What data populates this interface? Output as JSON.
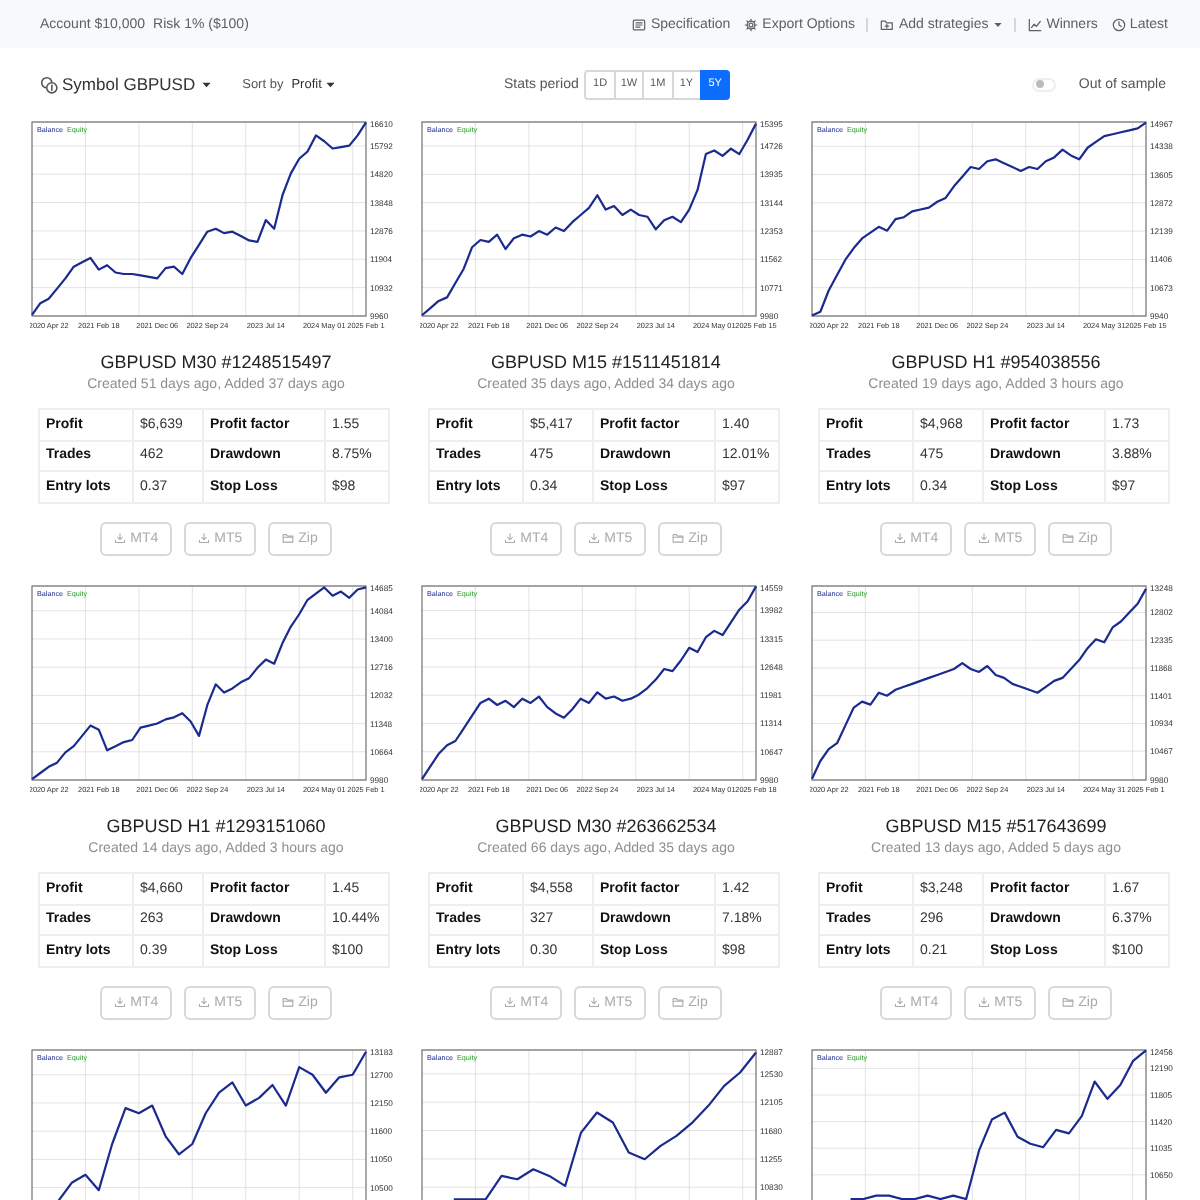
{
  "top_bar": {
    "account": "Account $10,000",
    "risk": "Risk 1% ($100)",
    "nav_groups": [
      {
        "items": [
          {
            "label": "Specification",
            "kind": "spec",
            "dropdown": false
          },
          {
            "label": "Export Options",
            "kind": "export",
            "dropdown": false
          }
        ]
      },
      {
        "items": [
          {
            "label": "Add strategies",
            "kind": "add",
            "dropdown": true
          }
        ]
      },
      {
        "items": [
          {
            "label": "Winners",
            "kind": "winners",
            "dropdown": false
          },
          {
            "label": "Latest",
            "kind": "latest",
            "dropdown": false
          }
        ]
      }
    ]
  },
  "toolbar": {
    "symbol": {
      "label": "Symbol GBPUSD"
    },
    "sort": {
      "label": "Sort by",
      "value": "Profit"
    },
    "stats_period": {
      "label": "Stats period",
      "options": [
        {
          "label": "1D",
          "selected": false
        },
        {
          "label": "1W",
          "selected": false
        },
        {
          "label": "1M",
          "selected": false
        },
        {
          "label": "1Y",
          "selected": false
        },
        {
          "label": "5Y",
          "selected": true
        }
      ]
    },
    "out_of_sample": {
      "label": "Out of sample",
      "on": false
    }
  },
  "cards": [
    {
      "chart_data": {
        "type": "line",
        "grid": true,
        "categories": [
          null,
          null,
          "2020 Apr 22",
          null,
          null,
          null,
          null,
          null,
          "2021 Feb 18",
          null,
          null,
          null,
          null,
          null,
          null,
          "2021 Dec 06",
          null,
          null,
          null,
          null,
          null,
          "2022 Sep 24",
          null,
          null,
          null,
          null,
          null,
          null,
          "2023 Jul 14",
          null,
          null,
          null,
          null,
          null,
          null,
          "2024 May 01",
          null,
          null,
          null,
          null,
          "2025 Feb 1"
        ],
        "ylim": [
          9960,
          16610
        ],
        "yticks": [
          9960,
          10932,
          11904,
          12876,
          13848,
          14820,
          15792,
          16610
        ],
        "series": [
          {
            "name": "Balance",
            "color": "#1b2a8e",
            "values": [
              10000,
              10400,
              10550,
              10900,
              11250,
              11650,
              11800,
              11950,
              11550,
              11700,
              11450,
              11400,
              11400,
              11350,
              11300,
              11250,
              11600,
              11650,
              11400,
              11950,
              12400,
              12850,
              12950,
              12800,
              12850,
              12700,
              12550,
              12500,
              13250,
              12950,
              14100,
              14850,
              15350,
              15600,
              16150,
              15950,
              15700,
              15750,
              15800,
              16150,
              16600
            ]
          },
          {
            "name": "Equity",
            "color": "#22a022",
            "values": [
              null,
              null,
              null,
              null,
              null,
              null,
              null,
              null,
              null,
              null,
              null,
              null,
              null,
              null,
              null,
              null,
              null,
              null,
              null,
              null,
              null,
              null,
              null,
              null,
              null,
              null,
              null,
              null,
              null,
              null,
              null,
              null,
              null,
              null,
              null,
              null,
              null,
              null,
              null,
              null,
              null
            ]
          }
        ]
      },
      "title": "GBPUSD M30 #1248515497",
      "subtitle": "Created 51 days ago, Added 37 days ago",
      "stats": [
        {
          "label": "Profit",
          "value": "$6,639"
        },
        {
          "label": "Profit factor",
          "value": "1.55"
        },
        {
          "label": "Trades",
          "value": "462"
        },
        {
          "label": "Drawdown",
          "value": "8.75%"
        },
        {
          "label": "Entry lots",
          "value": "0.37"
        },
        {
          "label": "Stop Loss",
          "value": "$98"
        }
      ],
      "buttons": [
        {
          "label": "MT4",
          "kind": "download",
          "disabled": true
        },
        {
          "label": "MT5",
          "kind": "download",
          "disabled": true
        },
        {
          "label": "Zip",
          "kind": "archive",
          "disabled": true
        }
      ]
    },
    {
      "chart_data": {
        "type": "line",
        "grid": true,
        "categories": [
          null,
          null,
          "2020 Apr 22",
          null,
          null,
          null,
          null,
          null,
          "2021 Feb 18",
          null,
          null,
          null,
          null,
          null,
          null,
          "2021 Dec 06",
          null,
          null,
          null,
          null,
          null,
          "2022 Sep 24",
          null,
          null,
          null,
          null,
          null,
          null,
          "2023 Jul 14",
          null,
          null,
          null,
          null,
          null,
          null,
          "2024 May 01",
          null,
          null,
          null,
          null,
          "2025 Feb 15"
        ],
        "ylim": [
          9980,
          15395
        ],
        "yticks": [
          9980,
          10771,
          11562,
          12353,
          13144,
          13935,
          14726,
          15395
        ],
        "series": [
          {
            "name": "Balance",
            "color": "#1b2a8e",
            "values": [
              10000,
              10200,
              10400,
              10500,
              10900,
              11300,
              11900,
              12100,
              12050,
              12250,
              11850,
              12150,
              12250,
              12200,
              12350,
              12250,
              12450,
              12350,
              12600,
              12800,
              13000,
              13350,
              12950,
              13050,
              12800,
              12950,
              12800,
              12750,
              12400,
              12650,
              12750,
              12600,
              12950,
              13500,
              14500,
              14600,
              14450,
              14650,
              14500,
              14900,
              15350
            ]
          },
          {
            "name": "Equity",
            "color": "#22a022",
            "values": [
              null,
              null,
              null,
              null,
              null,
              null,
              null,
              null,
              null,
              null,
              null,
              null,
              null,
              null,
              null,
              null,
              null,
              null,
              null,
              null,
              null,
              null,
              null,
              null,
              null,
              null,
              null,
              null,
              null,
              null,
              null,
              null,
              null,
              null,
              null,
              null,
              null,
              null,
              null,
              null,
              null
            ]
          }
        ]
      },
      "title": "GBPUSD M15 #1511451814",
      "subtitle": "Created 35 days ago, Added 34 days ago",
      "stats": [
        {
          "label": "Profit",
          "value": "$5,417"
        },
        {
          "label": "Profit factor",
          "value": "1.40"
        },
        {
          "label": "Trades",
          "value": "475"
        },
        {
          "label": "Drawdown",
          "value": "12.01%"
        },
        {
          "label": "Entry lots",
          "value": "0.34"
        },
        {
          "label": "Stop Loss",
          "value": "$97"
        }
      ],
      "buttons": [
        {
          "label": "MT4",
          "kind": "download",
          "disabled": true
        },
        {
          "label": "MT5",
          "kind": "download",
          "disabled": true
        },
        {
          "label": "Zip",
          "kind": "archive",
          "disabled": true
        }
      ]
    },
    {
      "chart_data": {
        "type": "line",
        "grid": true,
        "categories": [
          null,
          null,
          "2020 Apr 22",
          null,
          null,
          null,
          null,
          null,
          "2021 Feb 18",
          null,
          null,
          null,
          null,
          null,
          null,
          "2021 Dec 06",
          null,
          null,
          null,
          null,
          null,
          "2022 Sep 24",
          null,
          null,
          null,
          null,
          null,
          null,
          "2023 Jul 14",
          null,
          null,
          null,
          null,
          null,
          null,
          "2024 May 31",
          null,
          null,
          null,
          null,
          "2025 Feb 15"
        ],
        "ylim": [
          9940,
          14967
        ],
        "yticks": [
          9940,
          10673,
          11406,
          12139,
          12872,
          13605,
          14338,
          14967
        ],
        "series": [
          {
            "name": "Balance",
            "color": "#1b2a8e",
            "values": [
              9950,
              10050,
              10600,
              11000,
              11400,
              11700,
              11950,
              12100,
              12250,
              12150,
              12450,
              12500,
              12650,
              12700,
              12750,
              12900,
              13000,
              13300,
              13550,
              13800,
              13750,
              13950,
              14000,
              13900,
              13800,
              13700,
              13800,
              13750,
              13950,
              14050,
              14250,
              14100,
              14000,
              14300,
              14450,
              14600,
              14650,
              14700,
              14750,
              14800,
              14950
            ]
          },
          {
            "name": "Equity",
            "color": "#22a022",
            "values": [
              null,
              null,
              null,
              null,
              null,
              null,
              null,
              null,
              null,
              null,
              null,
              null,
              null,
              null,
              null,
              null,
              null,
              null,
              null,
              null,
              null,
              null,
              null,
              null,
              null,
              null,
              null,
              null,
              null,
              null,
              null,
              null,
              null,
              null,
              null,
              null,
              null,
              null,
              null,
              null,
              null
            ]
          }
        ]
      },
      "title": "GBPUSD H1 #954038556",
      "subtitle": "Created 19 days ago, Added 3 hours ago",
      "stats": [
        {
          "label": "Profit",
          "value": "$4,968"
        },
        {
          "label": "Profit factor",
          "value": "1.73"
        },
        {
          "label": "Trades",
          "value": "475"
        },
        {
          "label": "Drawdown",
          "value": "3.88%"
        },
        {
          "label": "Entry lots",
          "value": "0.34"
        },
        {
          "label": "Stop Loss",
          "value": "$97"
        }
      ],
      "buttons": [
        {
          "label": "MT4",
          "kind": "download",
          "disabled": true
        },
        {
          "label": "MT5",
          "kind": "download",
          "disabled": true
        },
        {
          "label": "Zip",
          "kind": "archive",
          "disabled": true
        }
      ]
    },
    {
      "chart_data": {
        "type": "line",
        "grid": true,
        "categories": [
          null,
          null,
          "2020 Apr 22",
          null,
          null,
          null,
          null,
          null,
          "2021 Feb 18",
          null,
          null,
          null,
          null,
          null,
          null,
          "2021 Dec 06",
          null,
          null,
          null,
          null,
          null,
          "2022 Sep 24",
          null,
          null,
          null,
          null,
          null,
          null,
          "2023 Jul 14",
          null,
          null,
          null,
          null,
          null,
          null,
          "2024 May 01",
          null,
          null,
          null,
          null,
          "2025 Feb 1"
        ],
        "ylim": [
          9980,
          14685
        ],
        "yticks": [
          9980,
          10664,
          11348,
          12032,
          12716,
          13400,
          14084,
          14685
        ],
        "series": [
          {
            "name": "Balance",
            "color": "#1b2a8e",
            "values": [
              10000,
              10150,
              10300,
              10400,
              10650,
              10800,
              11050,
              11300,
              11200,
              10700,
              10800,
              10900,
              10950,
              11250,
              11300,
              11350,
              11450,
              11500,
              11600,
              11400,
              11050,
              11800,
              12300,
              12100,
              12200,
              12350,
              12450,
              12700,
              12900,
              12800,
              13300,
              13700,
              14000,
              14350,
              14500,
              14650,
              14450,
              14550,
              14400,
              14600,
              14650
            ]
          },
          {
            "name": "Equity",
            "color": "#22a022",
            "values": [
              null,
              null,
              null,
              null,
              null,
              null,
              null,
              null,
              null,
              null,
              null,
              null,
              null,
              null,
              null,
              null,
              null,
              null,
              null,
              null,
              null,
              null,
              null,
              null,
              null,
              null,
              null,
              null,
              null,
              null,
              null,
              null,
              null,
              null,
              null,
              null,
              null,
              null,
              null,
              null,
              null
            ]
          }
        ]
      },
      "title": "GBPUSD H1 #1293151060",
      "subtitle": "Created 14 days ago, Added 3 hours ago",
      "stats": [
        {
          "label": "Profit",
          "value": "$4,660"
        },
        {
          "label": "Profit factor",
          "value": "1.45"
        },
        {
          "label": "Trades",
          "value": "263"
        },
        {
          "label": "Drawdown",
          "value": "10.44%"
        },
        {
          "label": "Entry lots",
          "value": "0.39"
        },
        {
          "label": "Stop Loss",
          "value": "$100"
        }
      ],
      "buttons": [
        {
          "label": "MT4",
          "kind": "download",
          "disabled": true
        },
        {
          "label": "MT5",
          "kind": "download",
          "disabled": true
        },
        {
          "label": "Zip",
          "kind": "archive",
          "disabled": true
        }
      ]
    },
    {
      "chart_data": {
        "type": "line",
        "grid": true,
        "categories": [
          null,
          null,
          "2020 Apr 22",
          null,
          null,
          null,
          null,
          null,
          "2021 Feb 18",
          null,
          null,
          null,
          null,
          null,
          null,
          "2021 Dec 06",
          null,
          null,
          null,
          null,
          null,
          "2022 Sep 24",
          null,
          null,
          null,
          null,
          null,
          null,
          "2023 Jul 14",
          null,
          null,
          null,
          null,
          null,
          null,
          "2024 May 01",
          null,
          null,
          null,
          null,
          "2025 Feb 18"
        ],
        "ylim": [
          9980,
          14559
        ],
        "yticks": [
          9980,
          10647,
          11314,
          11981,
          12648,
          13315,
          13982,
          14559
        ],
        "series": [
          {
            "name": "Balance",
            "color": "#1b2a8e",
            "values": [
              10000,
              10300,
              10600,
              10800,
              10900,
              11200,
              11500,
              11800,
              11900,
              11750,
              11850,
              11700,
              11900,
              11800,
              11950,
              11700,
              11550,
              11450,
              11650,
              11900,
              11800,
              12050,
              11900,
              11950,
              11850,
              11900,
              12000,
              12150,
              12350,
              12600,
              12550,
              12800,
              13100,
              13000,
              13350,
              13500,
              13400,
              13700,
              14000,
              14200,
              14550
            ]
          },
          {
            "name": "Equity",
            "color": "#22a022",
            "values": [
              null,
              null,
              null,
              null,
              null,
              null,
              null,
              null,
              null,
              null,
              null,
              null,
              null,
              null,
              null,
              null,
              null,
              null,
              null,
              null,
              null,
              null,
              null,
              null,
              null,
              null,
              null,
              null,
              null,
              null,
              null,
              null,
              null,
              null,
              null,
              null,
              null,
              null,
              null,
              null,
              null
            ]
          }
        ]
      },
      "title": "GBPUSD M30 #263662534",
      "subtitle": "Created 66 days ago, Added 35 days ago",
      "stats": [
        {
          "label": "Profit",
          "value": "$4,558"
        },
        {
          "label": "Profit factor",
          "value": "1.42"
        },
        {
          "label": "Trades",
          "value": "327"
        },
        {
          "label": "Drawdown",
          "value": "7.18%"
        },
        {
          "label": "Entry lots",
          "value": "0.30"
        },
        {
          "label": "Stop Loss",
          "value": "$98"
        }
      ],
      "buttons": [
        {
          "label": "MT4",
          "kind": "download",
          "disabled": true
        },
        {
          "label": "MT5",
          "kind": "download",
          "disabled": true
        },
        {
          "label": "Zip",
          "kind": "archive",
          "disabled": true
        }
      ]
    },
    {
      "chart_data": {
        "type": "line",
        "grid": true,
        "categories": [
          null,
          null,
          "2020 Apr 22",
          null,
          null,
          null,
          null,
          null,
          "2021 Feb 18",
          null,
          null,
          null,
          null,
          null,
          null,
          "2021 Dec 06",
          null,
          null,
          null,
          null,
          null,
          "2022 Sep 24",
          null,
          null,
          null,
          null,
          null,
          null,
          "2023 Jul 14",
          null,
          null,
          null,
          null,
          null,
          null,
          "2024 May 31",
          null,
          null,
          null,
          null,
          "2025 Feb 1"
        ],
        "ylim": [
          9980,
          13248
        ],
        "yticks": [
          9980,
          10467,
          10934,
          11401,
          11868,
          12335,
          12802,
          13248
        ],
        "series": [
          {
            "name": "Balance",
            "color": "#1b2a8e",
            "values": [
              10000,
              10300,
              10500,
              10600,
              10900,
              11200,
              11300,
              11250,
              11450,
              11400,
              11500,
              11550,
              11600,
              11650,
              11700,
              11750,
              11800,
              11850,
              11950,
              11850,
              11800,
              11900,
              11750,
              11700,
              11600,
              11550,
              11500,
              11450,
              11550,
              11650,
              11700,
              11850,
              12000,
              12200,
              12350,
              12300,
              12550,
              12650,
              12800,
              12950,
              13200
            ]
          },
          {
            "name": "Equity",
            "color": "#22a022",
            "values": [
              null,
              null,
              null,
              null,
              null,
              null,
              null,
              null,
              null,
              null,
              null,
              null,
              null,
              null,
              null,
              null,
              null,
              null,
              null,
              null,
              null,
              null,
              null,
              null,
              null,
              null,
              null,
              null,
              null,
              null,
              null,
              null,
              null,
              null,
              null,
              null,
              null,
              null,
              null,
              null,
              null
            ]
          }
        ]
      },
      "title": "GBPUSD M15 #517643699",
      "subtitle": "Created 13 days ago, Added 5 days ago",
      "stats": [
        {
          "label": "Profit",
          "value": "$3,248"
        },
        {
          "label": "Profit factor",
          "value": "1.67"
        },
        {
          "label": "Trades",
          "value": "296"
        },
        {
          "label": "Drawdown",
          "value": "6.37%"
        },
        {
          "label": "Entry lots",
          "value": "0.21"
        },
        {
          "label": "Stop Loss",
          "value": "$100"
        }
      ],
      "buttons": [
        {
          "label": "MT4",
          "kind": "download",
          "disabled": true
        },
        {
          "label": "MT5",
          "kind": "download",
          "disabled": true
        },
        {
          "label": "Zip",
          "kind": "archive",
          "disabled": true
        }
      ]
    },
    {
      "chart_data": {
        "type": "line",
        "grid": true,
        "ylim": [
          9400,
          13183
        ],
        "yticks": [
          10500,
          11050,
          11600,
          12150,
          12700,
          13183
        ],
        "series": [
          {
            "name": "Balance",
            "color": "#1b2a8e",
            "values": [
              null,
              null,
              10250,
              10600,
              10750,
              10450,
              11350,
              12050,
              11950,
              12100,
              11500,
              11150,
              11350,
              11950,
              12350,
              12550,
              12100,
              12250,
              12500,
              12100,
              12850,
              12700,
              12350,
              12650,
              12700,
              13150
            ]
          },
          {
            "name": "Equity",
            "color": "#22a022",
            "values": [
              null,
              null,
              null,
              null,
              null,
              null,
              null,
              null,
              null,
              null,
              null,
              null,
              null,
              null,
              null,
              null,
              null,
              null,
              null,
              null,
              null,
              null,
              null,
              null,
              null,
              null
            ]
          }
        ]
      }
    },
    {
      "chart_data": {
        "type": "line",
        "grid": true,
        "ylim": [
          9980,
          12887
        ],
        "yticks": [
          10830,
          11255,
          11680,
          12105,
          12530,
          12887
        ],
        "series": [
          {
            "name": "Balance",
            "color": "#1b2a8e",
            "values": [
              null,
              null,
              10650,
              10650,
              10650,
              11000,
              10950,
              11100,
              11000,
              10850,
              11650,
              11950,
              11800,
              11350,
              11250,
              11450,
              11600,
              11800,
              12050,
              12350,
              12550,
              12850
            ]
          },
          {
            "name": "Equity",
            "color": "#22a022",
            "values": [
              null,
              null,
              null,
              null,
              null,
              null,
              null,
              null,
              null,
              null,
              null,
              null,
              null,
              null,
              null,
              null,
              null,
              null,
              null,
              null,
              null,
              null
            ]
          }
        ]
      }
    },
    {
      "chart_data": {
        "type": "line",
        "grid": true,
        "ylim": [
          9650,
          12456
        ],
        "yticks": [
          10650,
          11035,
          11420,
          11805,
          12190,
          12456
        ],
        "series": [
          {
            "name": "Balance",
            "color": "#1b2a8e",
            "values": [
              null,
              null,
              null,
              10300,
              10300,
              10350,
              10350,
              10300,
              10300,
              10350,
              10300,
              10350,
              10300,
              11000,
              11450,
              11550,
              11200,
              11100,
              11050,
              11300,
              11250,
              11500,
              12000,
              11750,
              11950,
              12300,
              12450
            ]
          },
          {
            "name": "Equity",
            "color": "#22a022",
            "values": [
              null,
              null,
              null,
              null,
              null,
              null,
              null,
              null,
              null,
              null,
              null,
              null,
              null,
              null,
              null,
              null,
              null,
              null,
              null,
              null,
              null,
              null,
              null,
              null,
              null,
              null,
              null
            ]
          }
        ]
      }
    }
  ]
}
